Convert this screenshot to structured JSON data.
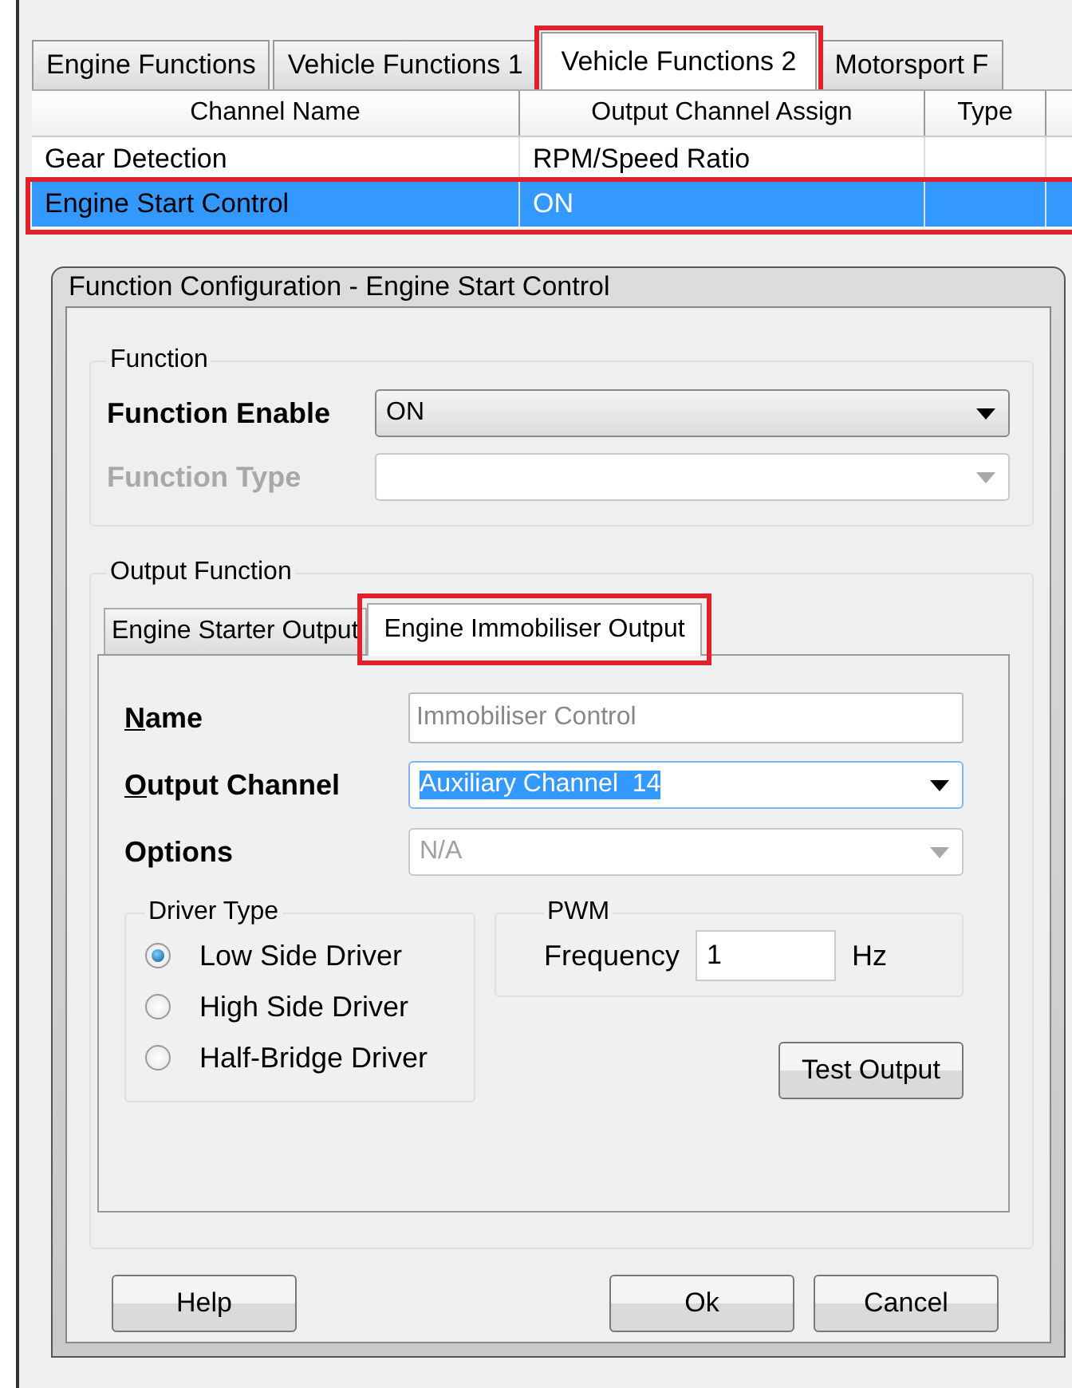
{
  "tabs": [
    {
      "label": "Engine Functions",
      "selected": false,
      "highlighted": false
    },
    {
      "label": "Vehicle Functions 1",
      "selected": false,
      "highlighted": false
    },
    {
      "label": "Vehicle Functions 2",
      "selected": true,
      "highlighted": true
    },
    {
      "label": "Motorsport F",
      "selected": false,
      "highlighted": false
    }
  ],
  "table": {
    "columns": [
      "Channel Name",
      "Output Channel Assign",
      "Type"
    ],
    "rows": [
      {
        "cells": [
          "Gear Detection",
          "RPM/Speed Ratio"
        ],
        "selected": false,
        "highlighted": false
      },
      {
        "cells": [
          "Engine Start Control",
          "ON"
        ],
        "selected": true,
        "highlighted": true
      }
    ]
  },
  "dialog": {
    "title": "Function Configuration - Engine Start Control",
    "function_group": {
      "legend": "Function",
      "fields": [
        {
          "label": "Function Enable",
          "value": "ON",
          "disabled": false
        },
        {
          "label": "Function Type",
          "disabled": true
        }
      ]
    },
    "output_function": {
      "legend": "Output Function",
      "tabs": [
        {
          "label": "Engine Starter Output",
          "selected": false,
          "highlighted": false
        },
        {
          "label": "Engine Immobiliser Output",
          "selected": true,
          "highlighted": true
        }
      ],
      "fields": [
        {
          "label": "Name",
          "kind": "text",
          "value": "Immobiliser Control",
          "disabled": true,
          "access_key": true,
          "text_selected": false
        },
        {
          "label": "Output Channel",
          "kind": "dropdown",
          "value": "Auxiliary Channel  14",
          "disabled": false,
          "access_key": true,
          "text_selected": true
        },
        {
          "label": "Options",
          "kind": "dropdown",
          "value": "N/A",
          "disabled": true,
          "access_key": false,
          "text_selected": false
        }
      ],
      "driver_type": {
        "legend": "Driver Type",
        "options": [
          {
            "label": "Low Side Driver",
            "selected": true
          },
          {
            "label": "High Side Driver",
            "selected": false
          },
          {
            "label": "Half-Bridge Driver",
            "selected": false
          }
        ]
      },
      "pwm": {
        "legend": "PWM",
        "label": "Frequency",
        "value": "1",
        "unit": "Hz"
      },
      "test_button": "Test Output"
    },
    "buttons": [
      "Help",
      "Ok",
      "Cancel"
    ]
  }
}
